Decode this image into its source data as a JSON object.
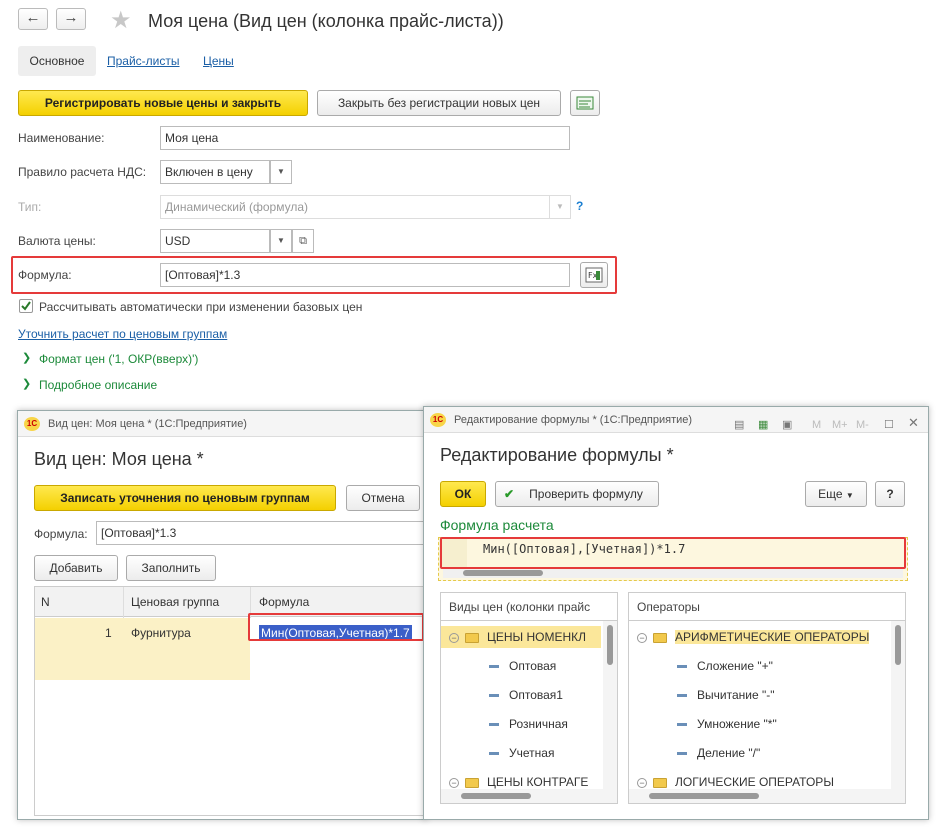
{
  "main": {
    "title": "Моя цена (Вид цен (колонка прайс-листа))",
    "nav": {
      "back": "←",
      "forward": "→",
      "star": "★"
    },
    "tabs": {
      "active": "Основное",
      "links": [
        "Прайс-листы",
        "Цены"
      ]
    },
    "buttons": {
      "register": "Регистрировать новые цены и закрыть",
      "close_no_reg": "Закрыть без регистрации новых цен"
    },
    "fields": {
      "name_label": "Наименование:",
      "name_value": "Моя цена",
      "vat_label": "Правило расчета НДС:",
      "vat_value": "Включен в цену",
      "type_label": "Тип:",
      "type_value": "Динамический (формула)",
      "type_help": "?",
      "currency_label": "Валюта цены:",
      "currency_value": "USD",
      "formula_label": "Формула:",
      "formula_value": "[Оптовая]*1.3"
    },
    "checkbox_label": "Рассчитывать автоматически при изменении базовых цен",
    "link_price_groups": "Уточнить расчет по ценовым группам",
    "collapsible": [
      "Формат цен ('1, ОКР(вверх)')",
      "Подробное описание"
    ]
  },
  "window_left": {
    "title_bar": "Вид цен: Моя цена *  (1С:Предприятие)",
    "heading": "Вид цен: Моя цена *",
    "save_button": "Записать уточнения по ценовым группам",
    "cancel_button": "Отмена",
    "formula_label": "Формула:",
    "formula_value": "[Оптовая]*1.3",
    "add_button": "Добавить",
    "fill_button": "Заполнить",
    "columns": [
      "N",
      "Ценовая группа",
      "Формула"
    ],
    "rows": [
      {
        "n": "1",
        "group": "Фурнитура",
        "formula": "Мин(Оптовая,Учетная)*1.7"
      }
    ]
  },
  "window_right": {
    "title_bar": "Редактирование формулы *  (1С:Предприятие)",
    "heading": "Редактирование формулы *",
    "ok_button": "ОК",
    "check_button": "Проверить формулу",
    "more_button": "Еще",
    "help_button": "?",
    "section_label": "Формула расчета",
    "formula_code": "Мин([Оптовая],[Учетная])*1.7",
    "toolbar_icons": [
      "M",
      "M+",
      "M-"
    ],
    "left_pane": {
      "header": "Виды цен (колонки прайс",
      "group1": "ЦЕНЫ НОМЕНКЛ",
      "items": [
        "Оптовая",
        "Оптовая1",
        "Розничная",
        "Учетная"
      ],
      "group2": "ЦЕНЫ КОНТРАГЕ"
    },
    "right_pane": {
      "header": "Операторы",
      "group1": "АРИФМЕТИЧЕСКИЕ ОПЕРАТОРЫ",
      "items": [
        "Сложение \"+\"",
        "Вычитание \"-\"",
        "Умножение \"*\"",
        "Деление \"/\""
      ],
      "group2": "ЛОГИЧЕСКИЕ ОПЕРАТОРЫ"
    }
  },
  "colors": {
    "accent_yellow": "#f4d000",
    "link_blue": "#1b5fa6",
    "green": "#1c8a3a",
    "highlight_red": "#e53a3a",
    "row_selected": "#fbf1c6"
  }
}
